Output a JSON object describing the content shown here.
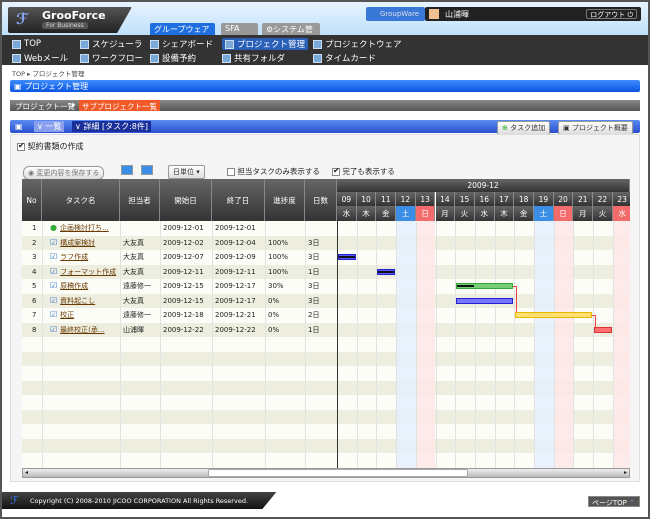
{
  "brand": {
    "name": "GrooForce",
    "sub": "For Business",
    "mark": "GF"
  },
  "top_tabs": [
    {
      "label": "グループウェア",
      "color": "#1f6fe0"
    },
    {
      "label": "SFA",
      "color": "#999"
    },
    {
      "label": "システム管理",
      "color": "#999"
    }
  ],
  "groupware_button": "GroupWare",
  "user": {
    "name": "山浦暉",
    "logout": "ログアウト"
  },
  "nav": [
    {
      "label": "TOP"
    },
    {
      "label": "スケジューラ"
    },
    {
      "label": "シェアボード"
    },
    {
      "label": "プロジェクト管理",
      "active": true
    },
    {
      "label": "プロジェクトウェア"
    },
    {
      "label": "Webメール"
    },
    {
      "label": "ワークフロー"
    },
    {
      "label": "設備予約"
    },
    {
      "label": "共有フォルダ"
    },
    {
      "label": "タイムカード"
    }
  ],
  "breadcrumb": [
    "TOP",
    "プロジェクト管理"
  ],
  "section_title": "プロジェクト管理",
  "subnav": {
    "parent": "プロジェクト一覧",
    "current": "サブプロジェクト一覧"
  },
  "view_bar": {
    "list": "一覧",
    "detail": "詳細",
    "count": "[タスク:8件]",
    "add_task": "タスク追加",
    "overview": "プロジェクト概要"
  },
  "project_name": "契約書類の作成",
  "toolbar": {
    "save": "変更内容を保存する",
    "unit": "日単位",
    "only_mine": "担当タスクのみ表示する",
    "only_mine_checked": false,
    "show_done": "完了も表示する",
    "show_done_checked": true
  },
  "columns": [
    "No",
    "タスク名",
    "担当者",
    "開始日",
    "終了日",
    "進捗度",
    "日数"
  ],
  "tasks": [
    {
      "no": "1",
      "name": "企画検討打ち...",
      "owner": "",
      "start": "2009-12-01",
      "end": "2009-12-01",
      "progress": "",
      "days": "",
      "milestone": true
    },
    {
      "no": "2",
      "name": "構成案検討",
      "owner": "大友真",
      "start": "2009-12-02",
      "end": "2009-12-04",
      "progress": "100%",
      "days": "3日"
    },
    {
      "no": "3",
      "name": "ラフ作成",
      "owner": "大友真",
      "start": "2009-12-07",
      "end": "2009-12-09",
      "progress": "100%",
      "days": "3日"
    },
    {
      "no": "4",
      "name": "フォーマット作成",
      "owner": "大友真",
      "start": "2009-12-11",
      "end": "2009-12-11",
      "progress": "100%",
      "days": "1日"
    },
    {
      "no": "5",
      "name": "原稿作成",
      "owner": "遠藤修一",
      "start": "2009-12-15",
      "end": "2009-12-17",
      "progress": "30%",
      "days": "3日"
    },
    {
      "no": "6",
      "name": "資料起こし",
      "owner": "大友真",
      "start": "2009-12-15",
      "end": "2009-12-17",
      "progress": "0%",
      "days": "3日"
    },
    {
      "no": "7",
      "name": "校正",
      "owner": "遠藤修一",
      "start": "2009-12-18",
      "end": "2009-12-21",
      "progress": "0%",
      "days": "2日"
    },
    {
      "no": "8",
      "name": "最終校正(承...",
      "owner": "山浦暉",
      "start": "2009-12-22",
      "end": "2009-12-22",
      "progress": "0%",
      "days": "1日"
    }
  ],
  "gantt": {
    "month": "2009-12",
    "days": [
      {
        "d": "09",
        "w": "水"
      },
      {
        "d": "10",
        "w": "木"
      },
      {
        "d": "11",
        "w": "金"
      },
      {
        "d": "12",
        "w": "土",
        "type": "sat"
      },
      {
        "d": "13",
        "w": "日",
        "type": "sun"
      },
      {
        "d": "14",
        "w": "月"
      },
      {
        "d": "15",
        "w": "火"
      },
      {
        "d": "16",
        "w": "水"
      },
      {
        "d": "17",
        "w": "木"
      },
      {
        "d": "18",
        "w": "金"
      },
      {
        "d": "19",
        "w": "土",
        "type": "sat"
      },
      {
        "d": "20",
        "w": "日",
        "type": "sun"
      },
      {
        "d": "21",
        "w": "月"
      },
      {
        "d": "22",
        "w": "火"
      },
      {
        "d": "23",
        "w": "水",
        "type": "sun"
      }
    ],
    "bars": [
      {
        "task": 3,
        "from": "09",
        "to": "09",
        "color": "#5a5aff",
        "progress": 100
      },
      {
        "task": 4,
        "from": "11",
        "to": "11",
        "color": "#5a5aff",
        "progress": 100
      },
      {
        "task": 5,
        "from": "15",
        "to": "17",
        "color": "#77cc77",
        "progress": 30
      },
      {
        "task": 6,
        "from": "15",
        "to": "17",
        "color": "#7777ff",
        "progress": 0
      },
      {
        "task": 7,
        "from": "18",
        "to": "21",
        "color": "#ffe070",
        "progress": 0
      },
      {
        "task": 8,
        "from": "22",
        "to": "22",
        "color": "#ff7070",
        "progress": 0
      }
    ],
    "colors": {
      "sat": "#3a8ee6",
      "sun": "#f46b6b",
      "sat_bg": "#e6f0fc",
      "sun_bg": "#fde8e8"
    }
  },
  "page_top": "ページTOP",
  "footer": "Copyright (C) 2008-2010 JICOO CORPORATION All Rights Reserved."
}
